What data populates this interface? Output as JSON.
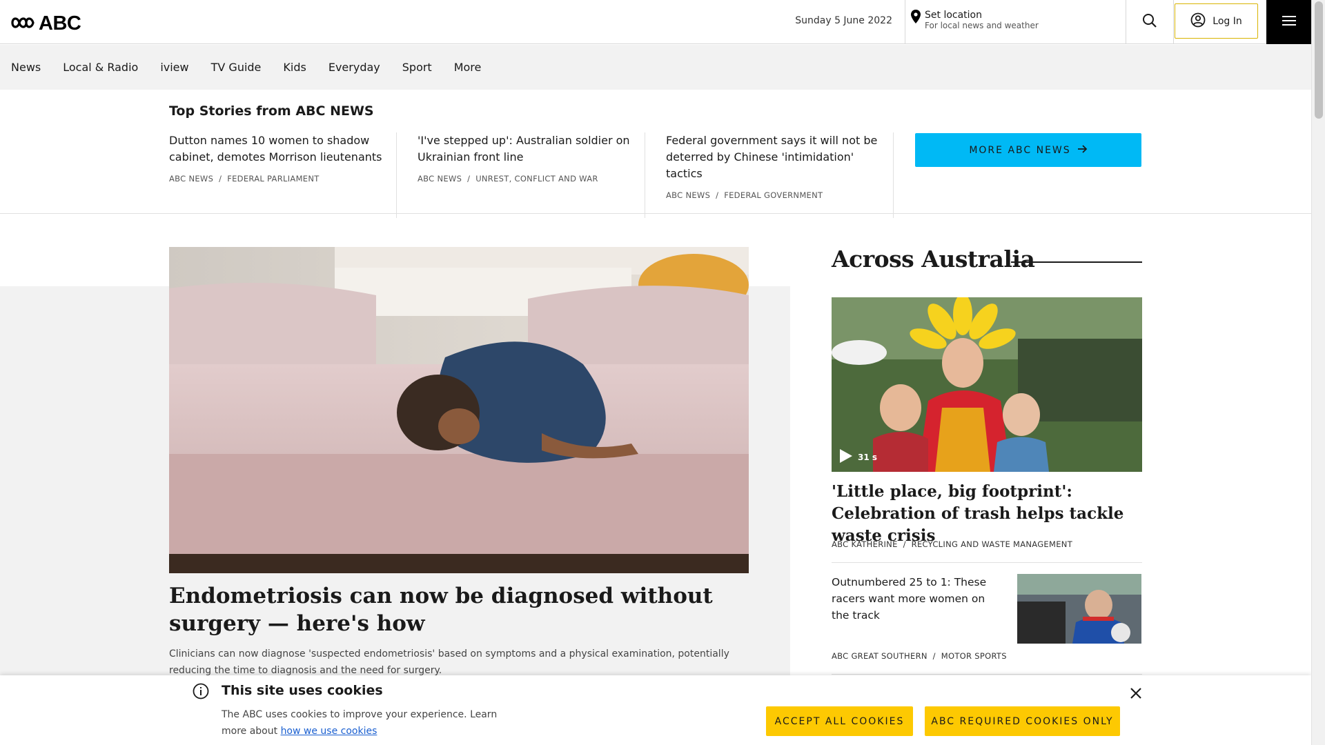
{
  "header": {
    "logo_text": "ABC",
    "date": "Sunday 5 June 2022",
    "location_title": "Set location",
    "location_subtitle": "For local news and weather",
    "login_label": "Log In",
    "icons": [
      "abc-lissajous-logo-icon",
      "location-pin-icon",
      "search-icon",
      "user-circle-icon",
      "hamburger-menu-icon"
    ]
  },
  "nav": {
    "items": [
      "News",
      "Local & Radio",
      "iview",
      "TV Guide",
      "Kids",
      "Everyday",
      "Sport",
      "More"
    ]
  },
  "top_stories": {
    "heading": "Top Stories from ABC NEWS",
    "stories": [
      {
        "title": "Dutton names 10 women to shadow cabinet, demotes Morrison lieutenants",
        "source": "ABC NEWS",
        "topic": "FEDERAL PARLIAMENT"
      },
      {
        "title": "'I've stepped up': Australian soldier on Ukrainian front line",
        "source": "ABC NEWS",
        "topic": "UNREST, CONFLICT AND WAR"
      },
      {
        "title": "Federal government says it will not be deterred by Chinese 'intimidation' tactics",
        "source": "ABC NEWS",
        "topic": "FEDERAL GOVERNMENT"
      }
    ],
    "more_label": "MORE ABC NEWS"
  },
  "hero": {
    "title": "Endometriosis can now be diagnosed without surgery — here's how",
    "description": "Clinicians can now diagnose 'suspected endometriosis' based on symptoms and a physical examination, potentially reducing the time to diagnosis and the need for surgery."
  },
  "across_australia": {
    "heading": "Across Australia",
    "feature": {
      "video_duration": "31 s",
      "title": "'Little place, big footprint': Celebration of trash helps tackle waste crisis",
      "source": "ABC KATHERINE",
      "topic": "RECYCLING AND WASTE MANAGEMENT"
    },
    "secondary": {
      "title": "Outnumbered 25 to 1: These racers want more women on the track",
      "source": "ABC GREAT SOUTHERN",
      "topic": "MOTOR SPORTS"
    }
  },
  "cookie_banner": {
    "title": "This site uses cookies",
    "text_before": "The ABC uses cookies to improve your experience. Learn more about ",
    "link_text": "how we use cookies",
    "accept_all": "ACCEPT ALL COOKIES",
    "required_only": "ABC REQUIRED COOKIES ONLY"
  },
  "colors": {
    "accent_blue": "#00b9f5",
    "accent_yellow": "#fdc902",
    "nav_bg": "#f2f2f2",
    "link_blue": "#1a5fd0"
  }
}
